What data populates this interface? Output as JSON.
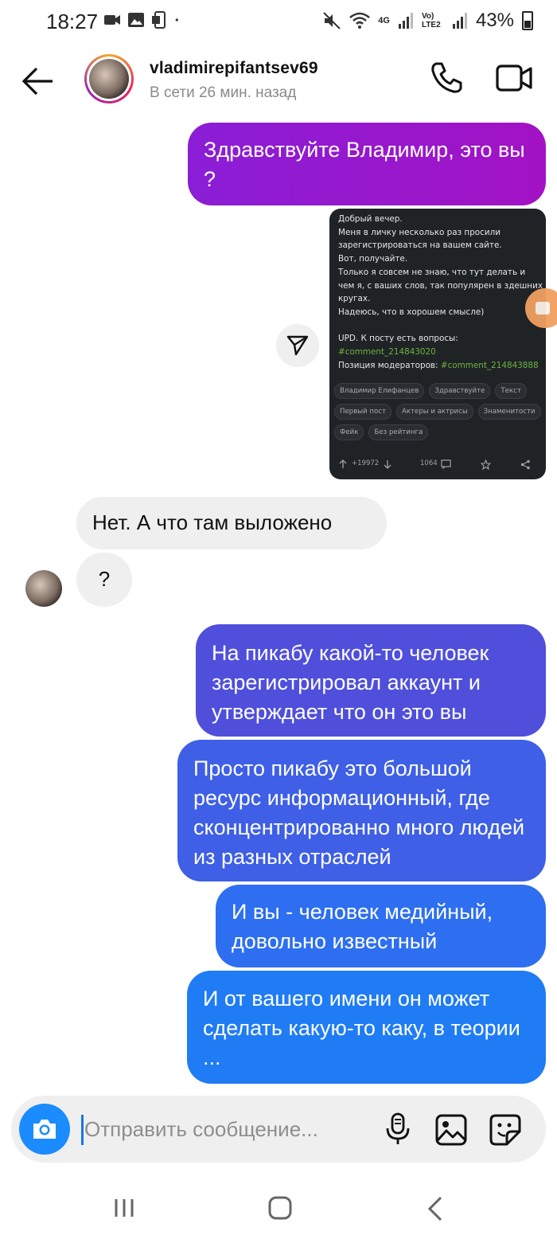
{
  "status_bar": {
    "time": "18:27",
    "network_4g": "4G",
    "network_lte": "Vo) LTE2",
    "battery": "43%"
  },
  "header": {
    "username": "vladimirepifantsev69",
    "status": "В сети 26 мин. назад",
    "icons": [
      "back-arrow-icon",
      "phone-icon",
      "video-camera-icon"
    ]
  },
  "messages": {
    "m1": "Здравствуйте Владимир, это вы ?",
    "in1": "Нет. А что там выложено",
    "in2": "?",
    "m5": "На пикабу какой-то человек зарегистрировал аккаунт и утверждает что он это вы",
    "m6": "Просто пикабу это большой ресурс информационный, где сконцентрированно много людей из разных отраслей",
    "m7": "И вы - человек медийный, довольно известный",
    "m8": "И от вашего имени он может сделать какую-то каку, в теории  ..."
  },
  "shared_post": {
    "line1": "Добрый вечер.",
    "line2": "Меня в личку несколько раз просили зарегистрироваться на вашем сайте.",
    "line3": "Вот, получайте.",
    "line4": "Только я совсем не знаю, что тут делать и чем я, с ваших слов, так популярен в здешних кругах.",
    "line5": "Надеюсь, что в хорошем смысле)",
    "upd": "UPD. К посту есть вопросы:",
    "comment1": "#comment_214843020",
    "moderators_label": "Позиция модераторов: ",
    "comment2": "#comment_214843888",
    "tags": [
      "Владимир Елифанцев",
      "Здравствуйте",
      "Текст",
      "Первый пост",
      "Актеры и актрисы",
      "Знаменитости",
      "Фейк",
      "Без рейтинга"
    ],
    "rating": "+19972",
    "comments_count": "1064"
  },
  "composer": {
    "placeholder": "Отправить сообщение..."
  },
  "colors": {
    "bubble_purple": "#a312c4",
    "bubble_blue": "#1f7cf5",
    "incoming_bg": "#efefef",
    "post_bg": "#202326",
    "link_green": "#6cb33f"
  }
}
